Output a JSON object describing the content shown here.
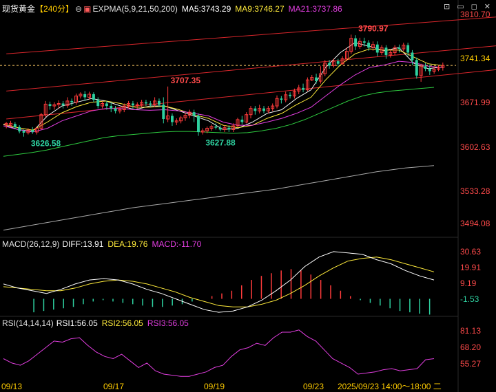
{
  "header": {
    "title": "现货黄金",
    "period": "【240分】",
    "expma_label": "EXPMA(5,9,21,50,200)",
    "ma5": "MA5:3743.29",
    "ma9": "MA9:3746.27",
    "ma21": "MA21:3737.86"
  },
  "window_icons": [
    "pin-icon",
    "minimize-icon",
    "maximize-icon",
    "close-icon"
  ],
  "colors": {
    "up": "#ff3b3b",
    "down": "#2ed1a0",
    "ma5": "#f2f2f2",
    "ma9": "#ffeb3b",
    "ma21": "#e23ee0",
    "ma50": "#2ecc40",
    "ma200": "#aaaaaa",
    "macd_dea": "#ffeb3b",
    "macd_diff": "#ffffff",
    "rsi": "#e23ee0"
  },
  "chart_data": {
    "type": "candlestick",
    "instrument": "现货黄金",
    "period": "240分",
    "price_axis": {
      "range": [
        3470,
        3829
      ],
      "ticks": [
        "3810.70",
        "3741.34",
        "3671.99",
        "3602.63",
        "3533.28",
        "3494.08"
      ],
      "current_price": "3741.34"
    },
    "x_labels": [
      "09/13",
      "09/17",
      "09/19",
      "09/23",
      "2025/09/23 14:00～18:00 二"
    ],
    "annotations": [
      {
        "text": "3626.58",
        "x": 5,
        "y": 3626.58,
        "color": "down",
        "pos": "below"
      },
      {
        "text": "3707.35",
        "x": 37,
        "y": 3707.35,
        "color": "up",
        "pos": "above"
      },
      {
        "text": "3627.88",
        "x": 45,
        "y": 3627.88,
        "color": "down",
        "pos": "below"
      },
      {
        "text": "3790.97",
        "x": 80,
        "y": 3790.97,
        "color": "up",
        "pos": "above"
      }
    ],
    "candles": [
      [
        3645,
        3648,
        3650,
        3640
      ],
      [
        3645,
        3648,
        3652,
        3642
      ],
      [
        3647,
        3642,
        3650,
        3639
      ],
      [
        3642,
        3635,
        3645,
        3632
      ],
      [
        3636,
        3633,
        3638,
        3626.58
      ],
      [
        3633,
        3637,
        3640,
        3630
      ],
      [
        3637,
        3634,
        3642,
        3631
      ],
      [
        3634,
        3640,
        3643,
        3630
      ],
      [
        3640,
        3662,
        3665,
        3638
      ],
      [
        3662,
        3679,
        3684,
        3658
      ],
      [
        3679,
        3676,
        3683,
        3670
      ],
      [
        3676,
        3678,
        3682,
        3670
      ],
      [
        3678,
        3680,
        3685,
        3672
      ],
      [
        3680,
        3677,
        3684,
        3672
      ],
      [
        3677,
        3684,
        3690,
        3673
      ],
      [
        3684,
        3682,
        3688,
        3676
      ],
      [
        3682,
        3692,
        3696,
        3678
      ],
      [
        3692,
        3695,
        3698,
        3688
      ],
      [
        3695,
        3690,
        3700,
        3684
      ],
      [
        3690,
        3695,
        3699,
        3686
      ],
      [
        3695,
        3686,
        3698,
        3682
      ],
      [
        3686,
        3676,
        3690,
        3672
      ],
      [
        3676,
        3680,
        3684,
        3672
      ],
      [
        3680,
        3676,
        3684,
        3670
      ],
      [
        3676,
        3672,
        3682,
        3666
      ],
      [
        3672,
        3668,
        3676,
        3664
      ],
      [
        3668,
        3670,
        3674,
        3664
      ],
      [
        3670,
        3676,
        3680,
        3666
      ],
      [
        3676,
        3680,
        3684,
        3672
      ],
      [
        3680,
        3677,
        3684,
        3672
      ],
      [
        3677,
        3678,
        3682,
        3672
      ],
      [
        3678,
        3682,
        3686,
        3674
      ],
      [
        3682,
        3680,
        3686,
        3676
      ],
      [
        3680,
        3678,
        3684,
        3674
      ],
      [
        3678,
        3684,
        3690,
        3674
      ],
      [
        3684,
        3678,
        3688,
        3674
      ],
      [
        3678,
        3655,
        3690,
        3648
      ],
      [
        3655,
        3660,
        3707.35,
        3650
      ],
      [
        3660,
        3650,
        3664,
        3644
      ],
      [
        3650,
        3652,
        3656,
        3645
      ],
      [
        3652,
        3657,
        3660,
        3648
      ],
      [
        3657,
        3661,
        3665,
        3652
      ],
      [
        3661,
        3666,
        3670,
        3656
      ],
      [
        3666,
        3660,
        3670,
        3650
      ],
      [
        3660,
        3634,
        3664,
        3627.88
      ],
      [
        3634,
        3636,
        3640,
        3630
      ],
      [
        3636,
        3640,
        3643,
        3632
      ],
      [
        3640,
        3643,
        3646,
        3636
      ],
      [
        3643,
        3641,
        3648,
        3638
      ],
      [
        3641,
        3638,
        3645,
        3635
      ],
      [
        3638,
        3641,
        3645,
        3634
      ],
      [
        3641,
        3638,
        3645,
        3634
      ],
      [
        3638,
        3644,
        3648,
        3634
      ],
      [
        3644,
        3654,
        3657,
        3642
      ],
      [
        3654,
        3650,
        3660,
        3646
      ],
      [
        3650,
        3662,
        3666,
        3648
      ],
      [
        3662,
        3672,
        3676,
        3656
      ],
      [
        3672,
        3668,
        3676,
        3662
      ],
      [
        3668,
        3672,
        3678,
        3664
      ],
      [
        3672,
        3668,
        3676,
        3664
      ],
      [
        3668,
        3672,
        3676,
        3664
      ],
      [
        3672,
        3676,
        3680,
        3668
      ],
      [
        3676,
        3688,
        3693,
        3672
      ],
      [
        3688,
        3686,
        3692,
        3680
      ],
      [
        3686,
        3694,
        3699,
        3682
      ],
      [
        3694,
        3692,
        3698,
        3688
      ],
      [
        3692,
        3700,
        3704,
        3688
      ],
      [
        3700,
        3705,
        3710,
        3695
      ],
      [
        3705,
        3702,
        3712,
        3698
      ],
      [
        3702,
        3718,
        3722,
        3700
      ],
      [
        3718,
        3722,
        3726,
        3716
      ],
      [
        3722,
        3716,
        3728,
        3712
      ],
      [
        3716,
        3728,
        3740,
        3712
      ],
      [
        3728,
        3745,
        3750,
        3724
      ],
      [
        3745,
        3741,
        3750,
        3736
      ],
      [
        3741,
        3748,
        3752,
        3738
      ],
      [
        3748,
        3744,
        3752,
        3740
      ],
      [
        3744,
        3752,
        3756,
        3742
      ],
      [
        3752,
        3764,
        3770,
        3748
      ],
      [
        3764,
        3785,
        3790.97,
        3760
      ],
      [
        3785,
        3772,
        3790,
        3766
      ],
      [
        3772,
        3780,
        3786,
        3768
      ],
      [
        3780,
        3778,
        3786,
        3772
      ],
      [
        3778,
        3770,
        3782,
        3765
      ],
      [
        3770,
        3775,
        3780,
        3765
      ],
      [
        3775,
        3762,
        3780,
        3756
      ],
      [
        3762,
        3770,
        3774,
        3758
      ],
      [
        3770,
        3758,
        3774,
        3752
      ],
      [
        3758,
        3762,
        3768,
        3754
      ],
      [
        3762,
        3770,
        3774,
        3758
      ],
      [
        3770,
        3768,
        3775,
        3762
      ],
      [
        3768,
        3774,
        3778,
        3764
      ],
      [
        3774,
        3762,
        3778,
        3756
      ],
      [
        3762,
        3750,
        3766,
        3742
      ],
      [
        3750,
        3725,
        3754,
        3720
      ],
      [
        3725,
        3740,
        3744,
        3715
      ],
      [
        3740,
        3736,
        3745,
        3732
      ],
      [
        3736,
        3732,
        3742,
        3726
      ],
      [
        3732,
        3735,
        3740,
        3728
      ],
      [
        3735,
        3738,
        3742,
        3732
      ],
      [
        3738,
        3741.34,
        3746,
        3733
      ]
    ],
    "ema": {
      "ema5": [
        3646,
        3638,
        3635,
        3660,
        3676,
        3682,
        3688,
        3684,
        3676,
        3670,
        3676,
        3676,
        3668,
        3660,
        3652,
        3638,
        3640,
        3650,
        3664,
        3670,
        3688,
        3702,
        3738,
        3762,
        3778,
        3772,
        3765,
        3770,
        3745,
        3736,
        3739
      ],
      "ema9": [
        3647,
        3641,
        3637,
        3650,
        3665,
        3675,
        3682,
        3684,
        3680,
        3674,
        3674,
        3676,
        3670,
        3662,
        3656,
        3645,
        3641,
        3645,
        3656,
        3664,
        3678,
        3690,
        3718,
        3742,
        3760,
        3768,
        3766,
        3766,
        3755,
        3744,
        3741
      ],
      "ema21": [
        3644,
        3638,
        3634,
        3640,
        3652,
        3660,
        3668,
        3672,
        3672,
        3670,
        3669,
        3670,
        3668,
        3664,
        3660,
        3650,
        3645,
        3645,
        3650,
        3656,
        3664,
        3674,
        3692,
        3710,
        3726,
        3738,
        3742,
        3748,
        3746,
        3740,
        3738
      ],
      "ema50": [
        3595,
        3598,
        3601,
        3605,
        3610,
        3615,
        3620,
        3625,
        3628,
        3630,
        3632,
        3634,
        3635,
        3635,
        3634,
        3633,
        3632,
        3633,
        3636,
        3640,
        3646,
        3654,
        3664,
        3674,
        3684,
        3692,
        3697,
        3700,
        3702,
        3704,
        3706
      ],
      "ema200": [
        3476,
        3480,
        3484,
        3488,
        3492,
        3496,
        3500,
        3504,
        3508,
        3512,
        3515,
        3518,
        3521,
        3524,
        3527,
        3530,
        3533,
        3536,
        3539,
        3542,
        3546,
        3550,
        3554,
        3558,
        3562,
        3566,
        3570,
        3573,
        3576,
        3578,
        3580
      ]
    },
    "channel_lines": [
      {
        "from": [
          0,
          3760
        ],
        "to": [
          123,
          3825
        ]
      },
      {
        "from": [
          0,
          3700
        ],
        "to": [
          123,
          3780
        ]
      },
      {
        "from": [
          0,
          3655
        ],
        "to": [
          123,
          3742
        ]
      }
    ],
    "macd": {
      "label": "MACD(26,12,9)",
      "diff_label": "DIFF:13.91",
      "dea_label": "DEA:19.76",
      "macd_label": "MACD:-11.70",
      "ticks": [
        "30.63",
        "19.91",
        "9.19",
        "-1.53"
      ],
      "range": [
        -13,
        38
      ],
      "diff": [
        11,
        8,
        6,
        4,
        7,
        11,
        14,
        15,
        14,
        11,
        7,
        4,
        0,
        -4,
        -8,
        -10,
        -9,
        -6,
        -1,
        6,
        14,
        24,
        31,
        35,
        34,
        33,
        29,
        26,
        21,
        17,
        14
      ],
      "dea": [
        9,
        8,
        7,
        6,
        6,
        8,
        11,
        13,
        14,
        13,
        11,
        8,
        5,
        1,
        -2,
        -5,
        -6,
        -6,
        -4,
        -1,
        4,
        10,
        17,
        23,
        28,
        30,
        31,
        29,
        26,
        23,
        20
      ],
      "bars": [
        -10,
        -9,
        -8,
        -7,
        -6,
        -4,
        -2,
        -1,
        -2,
        -3,
        -4,
        -5,
        -6,
        -6,
        -5,
        -4,
        -2,
        0,
        2,
        4,
        6,
        10,
        14,
        17,
        19,
        21,
        22,
        21,
        18,
        14,
        10,
        6,
        2,
        -1,
        -3,
        -5,
        -7,
        -9,
        -10,
        -11,
        -11.7
      ],
      "bar_start": 3
    },
    "rsi": {
      "label": "RSI(14,14,14)",
      "rsi1_label": "RSI1:56.05",
      "rsi2_label": "RSI2:56.05",
      "rsi3_label": "RSI3:56.05",
      "ticks": [
        "81.13",
        "68.20",
        "55.27"
      ],
      "range": [
        37,
        85
      ],
      "values": [
        56,
        52,
        50,
        54,
        60,
        66,
        72,
        71,
        74,
        75,
        68,
        62,
        58,
        56,
        60,
        54,
        48,
        52,
        45,
        42,
        41,
        40,
        40,
        42,
        44,
        48,
        50,
        58,
        64,
        66,
        70,
        68,
        75,
        80,
        80,
        82,
        76,
        72,
        64,
        56,
        52,
        48,
        42,
        43,
        44,
        46,
        47,
        45,
        46,
        47,
        55,
        56
      ]
    }
  }
}
